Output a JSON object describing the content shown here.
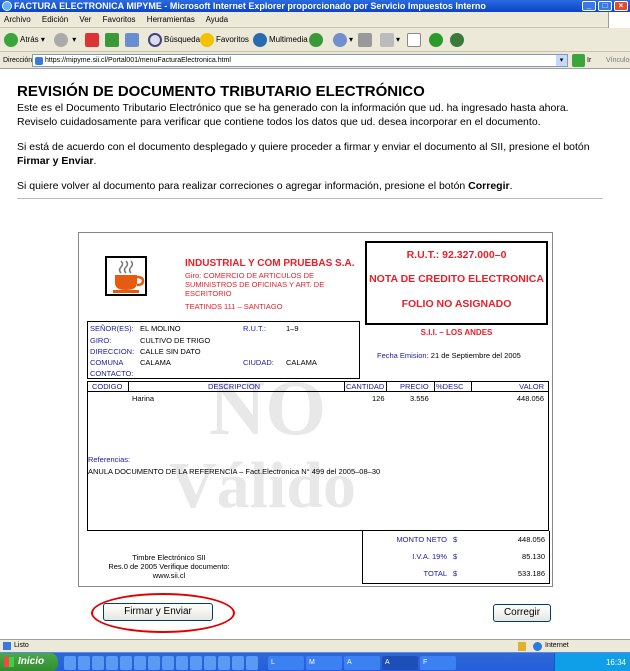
{
  "window": {
    "title": "FACTURA ELECTRONICA MIPYME - Microsoft Internet Explorer proporcionado por Servicio Impuestos Interno"
  },
  "menu": [
    "Archivo",
    "Edición",
    "Ver",
    "Favoritos",
    "Herramientas",
    "Ayuda"
  ],
  "toolbar": {
    "back": "Atrás",
    "search": "Búsqueda",
    "favorites": "Favoritos",
    "multimedia": "Multimedia"
  },
  "address": {
    "label": "Dirección",
    "url": "https://mipyme.sii.cl/Portal001/menuFacturaElectronica.html",
    "go": "Ir",
    "links": "Vínculos"
  },
  "page": {
    "heading": "REVISIÓN DE DOCUMENTO TRIBUTARIO ELECTRÓNICO",
    "intro1": "Este es el Documento Tributario Electrónico que se ha generado con la información que ud. ha ingresado hasta ahora.",
    "intro2": "Reviselo cuidadosamente para verificar que contiene todos los datos que ud. desea incorporar en el documento.",
    "sign_text_a": "Si está de acuerdo con el documento desplegado y quiere proceder a firmar y enviar el documento al SII, presione el botón",
    "sign_text_b": "Firmar y Enviar",
    "sign_text_c": ".",
    "fix_text_a": "Si quiere volver al documento para realizar correciones o agregar información, presione el botón",
    "fix_text_b": "Corregir",
    "fix_text_c": "."
  },
  "document": {
    "company_name": "INDUSTRIAL Y COM PRUEBAS S.A.",
    "giro": "Giro: COMERCIO DE ARTICULOS DE SUMINISTROS DE OFICINAS Y ART. DE ESCRITORIO",
    "address": "TEATINOS 111 – SANTIAGO",
    "rut": "R.U.T.: 92.327.000–0",
    "doc_type": "NOTA DE CREDITO ELECTRONICA",
    "folio": "FOLIO NO ASIGNADO",
    "sii": "S.I.I. – LOS ANDES",
    "fecha_label": "Fecha Emision:",
    "fecha": "21 de Septiembre del 2005",
    "receiver": {
      "senores_label": "SEÑOR(ES):",
      "senores": "EL MOLINO",
      "rut_label": "R.U.T.:",
      "rut": "1–9",
      "giro_label": "GIRO:",
      "giro": "CULTIVO DE TRIGO",
      "direccion_label": "DIRECCION:",
      "direccion": "CALLE SIN DATO",
      "comuna_label": "COMUNA",
      "comuna": "CALAMA",
      "ciudad_label": "CIUDAD:",
      "ciudad": "CALAMA",
      "contacto_label": "CONTACTO:"
    },
    "columns": [
      "CODIGO",
      "DESCRIPCION",
      "CANTIDAD",
      "PRECIO",
      "%DESC",
      "VALOR"
    ],
    "items": [
      {
        "codigo": "",
        "descripcion": "Harina",
        "cantidad": "126",
        "precio": "3.556",
        "desc": "",
        "valor": "448.056"
      }
    ],
    "referencias_label": "Referencias:",
    "referencia": "ANULA DOCUMENTO DE LA REFERENCIA – Fact.Electronica N° 499 del 2005–08–30",
    "watermark_1": "NO",
    "watermark_2": "Válido",
    "timbre_1": "Timbre Electrónico SII",
    "timbre_2": "Res.0 de 2005 Verifique documento:",
    "timbre_3": "www.sii.cl",
    "totals": [
      {
        "label": "MONTO NETO",
        "currency": "$",
        "value": "448.056"
      },
      {
        "label": "I.V.A. 19%",
        "currency": "$",
        "value": "85.130"
      },
      {
        "label": "TOTAL",
        "currency": "$",
        "value": "533.186"
      }
    ]
  },
  "buttons": {
    "sign": "Firmar y Enviar",
    "fix": "Corregir"
  },
  "status": {
    "left": "Listo",
    "zone": "Internet"
  },
  "taskbar": {
    "start": "Inicio",
    "tasks": [
      "L",
      "M",
      "A",
      "A",
      "F"
    ],
    "clock": "16:34"
  },
  "colors": {
    "accent_red": "#e8202a",
    "label_blue": "#1a1aa0",
    "highlight_ring": "#e00000"
  }
}
